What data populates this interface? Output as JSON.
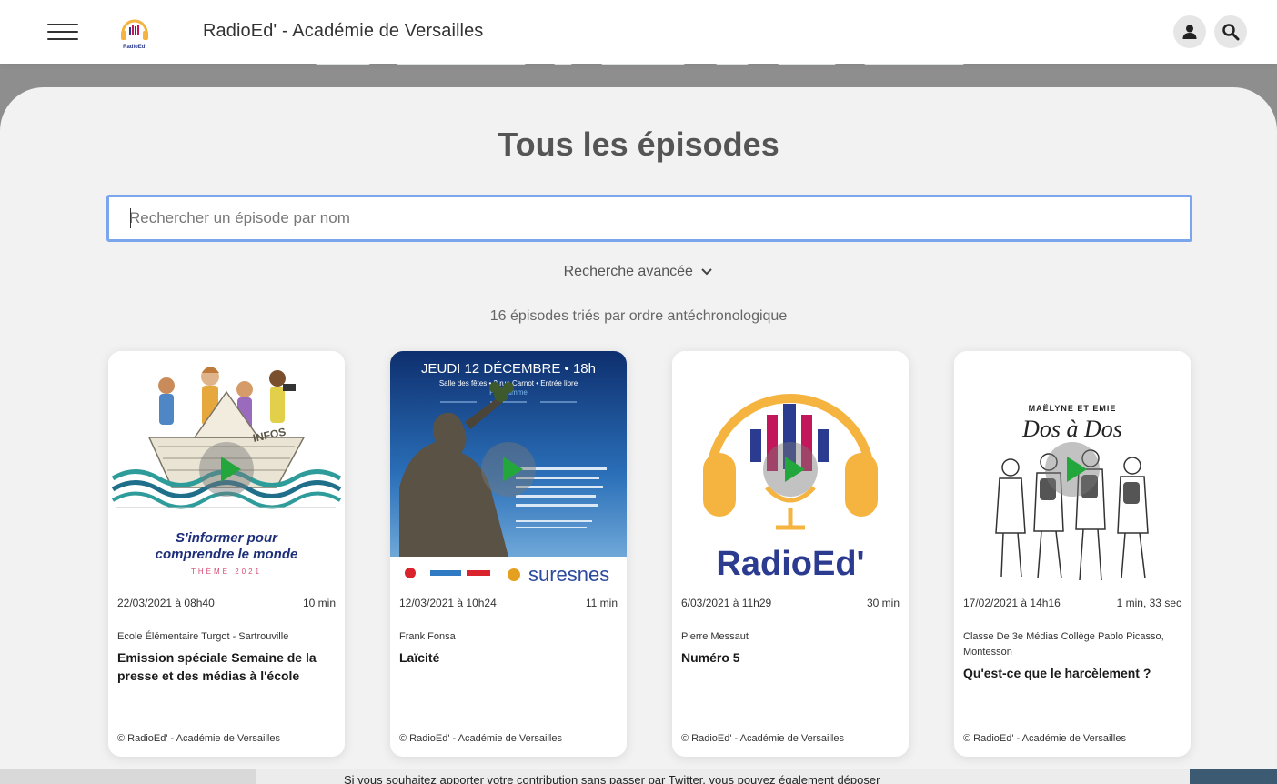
{
  "header": {
    "site_title": "RadioEd' - Académie de Versailles",
    "logo_text": "RadioEd'"
  },
  "main": {
    "title": "Tous les épisodes",
    "search_placeholder": "Rechercher un épisode par nom",
    "advanced_search": "Recherche avancée",
    "results_count": "16 épisodes triés par ordre antéchronologique"
  },
  "cards": [
    {
      "date": "22/03/2021 à 08h40",
      "duration": "10 min",
      "author": "Ecole Élémentaire Turgot - Sartrouville",
      "title": "Emission spéciale Semaine de la presse et des médias à l'école",
      "copyright": "© RadioEd' - Académie de Versailles",
      "thumb_line1": "S'informer pour",
      "thumb_line2": "comprendre le monde",
      "thumb_theme": "THÈME 2021",
      "thumb_sign": "INFOS"
    },
    {
      "date": "12/03/2021 à 10h24",
      "duration": "11 min",
      "author": "Frank Fonsa",
      "title": "Laïcité",
      "copyright": "© RadioEd' - Académie de Versailles",
      "thumb_headline": "JEUDI 12 DÉCEMBRE • 18h",
      "thumb_subline": "Salle des fêtes • 2 rue Carnot • Entrée libre",
      "thumb_program": "Programme",
      "thumb_brand": "suresnes"
    },
    {
      "date": "6/03/2021 à 11h29",
      "duration": "30 min",
      "author": "Pierre Messaut",
      "title": "Numéro 5",
      "copyright": "© RadioEd' - Académie de Versailles",
      "thumb_brand": "RadioEd'"
    },
    {
      "date": "17/02/2021 à 14h16",
      "duration": "1 min, 33 sec",
      "author": "Classe De 3e Médias Collège Pablo Picasso, Montesson",
      "title": "Qu'est-ce que le harcèlement ?",
      "copyright": "© RadioEd' - Académie de Versailles",
      "thumb_kicker": "MAËLYNE ET EMIE",
      "thumb_script": "Dos à Dos"
    }
  ],
  "background": {
    "text": "Si vous souhaitez apporter votre contribution sans passer par Twitter, vous pouvez également déposer"
  },
  "colors": {
    "accent_focus": "#7ba6ee",
    "play_green": "#23a63c",
    "brand_blue": "#2b3b8f",
    "brand_magenta": "#c2185b",
    "brand_orange": "#f5b340"
  }
}
